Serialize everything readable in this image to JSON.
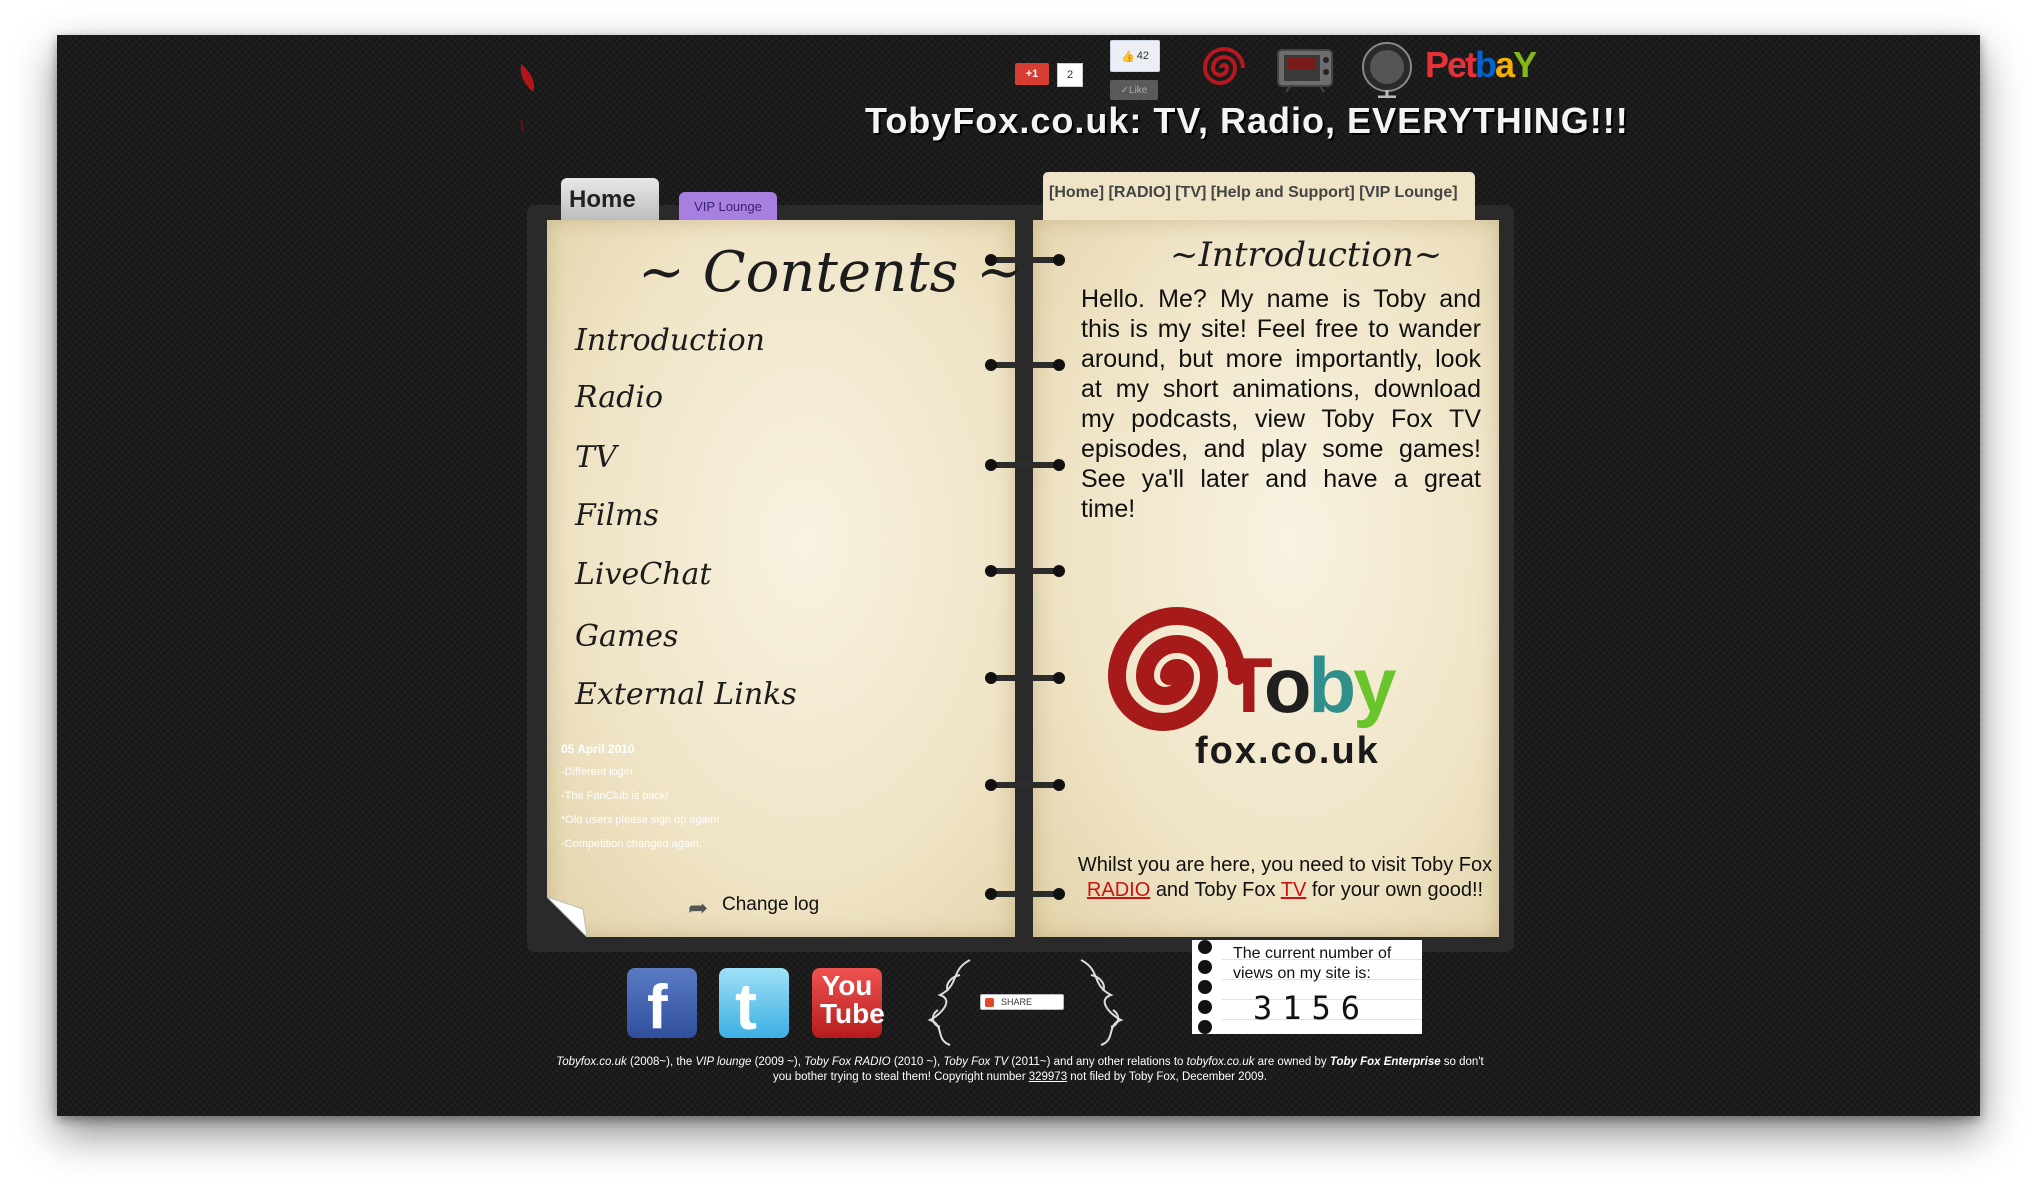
{
  "header": {
    "gplus_label": "+1",
    "gplus_count": "2",
    "fb_like_count": "42",
    "fb_like_button": "Like",
    "petbay_text": "PetbaY",
    "site_title": "TobyFox.co.uk: TV, Radio, EVERYTHING!!!"
  },
  "tabs": {
    "home": "Home",
    "vip": "VIP Lounge"
  },
  "topnav": "[Home] [RADIO] [TV] [Help and Support] [VIP Lounge]",
  "contents": {
    "title": "~ Contents ~",
    "items": [
      "Introduction",
      "Radio",
      "TV",
      "Films",
      "LiveChat",
      "Games",
      "External Links"
    ]
  },
  "news": {
    "date": "05 April 2010",
    "lines": [
      "-Different login",
      "-The FanClub is back!",
      "*Old users please sign up again!",
      "-Competition changed again."
    ]
  },
  "changelog_label": "Change log",
  "intro": {
    "title": "~Introduction~",
    "text": "Hello. Me? My name is Toby and this is my site! Feel free to wander around, but more importantly, look at my short animations, download my podcasts, view Toby Fox TV episodes, and play some games! See ya'll later and have a great time!"
  },
  "logo": {
    "word1": "Toby",
    "word2": "fox.co.uk"
  },
  "visit": {
    "pre": "Whilst you are here, you need to visit Toby Fox",
    "radio_link": "RADIO",
    "mid": "and Toby Fox",
    "tv_link": "TV",
    "post": "for your own good!!"
  },
  "social": {
    "facebook": "f",
    "youtube_top": "You",
    "youtube_bottom": "Tube",
    "share": "SHARE"
  },
  "counter": {
    "label": "The current number of views on my site is:",
    "value": "3156"
  },
  "footer": {
    "p1": "Tobyfox.co.uk",
    "p2": " (2008~), the ",
    "p3": "VIP lounge",
    "p4": " (2009 ~), ",
    "p5": "Toby Fox RADIO",
    "p6": " (2010 ~), ",
    "p7": "Toby Fox TV",
    "p8": " (2011~) and any  other relations to ",
    "p9": "tobyfox.co.uk",
    "p10": "  are owned by ",
    "p11": "Toby Fox Enterprise",
    "p12": " so don't you bother trying to steal them! Copyright number ",
    "p13": "329973",
    "p14": " not filed by Toby Fox, December 2009."
  },
  "colors": {
    "background": "#1c1c1c",
    "page": "#efe4c6",
    "logo_red": "#a61a1a",
    "logo_teal": "#2f8f8a",
    "logo_green": "#6ac42c",
    "link_red": "#cc1111"
  }
}
